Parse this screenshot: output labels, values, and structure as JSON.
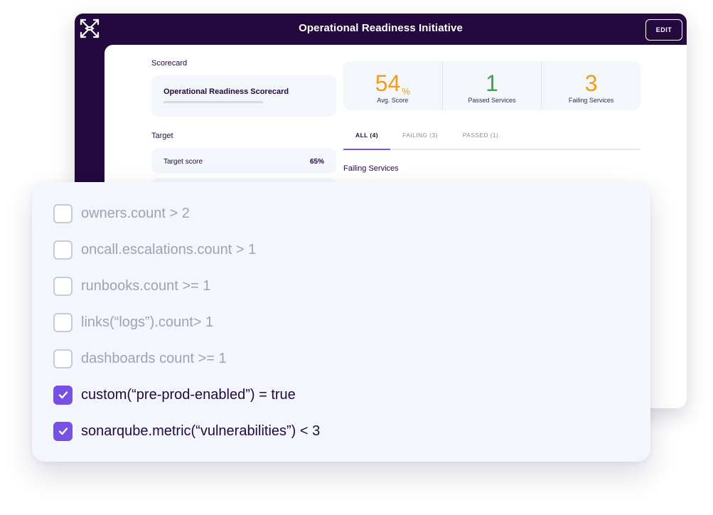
{
  "window": {
    "title": "Operational Readiness Initiative",
    "edit_label": "EDIT"
  },
  "sidebar": {
    "logo_icon": "starburst-logo-icon"
  },
  "scorecard": {
    "label": "Scorecard",
    "name": "Operational Readiness Scorecard"
  },
  "target": {
    "label": "Target",
    "row_label": "Target score",
    "row_value": "65%"
  },
  "stats": [
    {
      "value": "54",
      "unit": "%",
      "label": "Avg. Score",
      "color": "#f39c1a"
    },
    {
      "value": "1",
      "unit": "",
      "label": "Passed Services",
      "color": "#3aa64b"
    },
    {
      "value": "3",
      "unit": "",
      "label": "Failing Services",
      "color": "#f39c1a"
    }
  ],
  "tabs": [
    {
      "label": "ALL (4)",
      "active": true
    },
    {
      "label": "FAILING (3)",
      "active": false
    },
    {
      "label": "PASSED (1)",
      "active": false
    }
  ],
  "failing_heading": "Failing Services",
  "rules": [
    {
      "text": "owners.count > 2",
      "checked": false
    },
    {
      "text": "oncall.escalations.count > 1",
      "checked": false
    },
    {
      "text": "runbooks.count >= 1",
      "checked": false
    },
    {
      "text": "links(“logs”).count> 1",
      "checked": false
    },
    {
      "text": "dashboards count >= 1",
      "checked": false
    },
    {
      "text": "custom(“pre-prod-enabled”) = true",
      "checked": true
    },
    {
      "text": "sonarqube.metric(“vulnerabilities”) < 3",
      "checked": true
    }
  ],
  "colors": {
    "brand_dark": "#24093f",
    "accent_purple": "#7651e3",
    "score_orange": "#f39c1a",
    "pass_green": "#3aa64b"
  }
}
